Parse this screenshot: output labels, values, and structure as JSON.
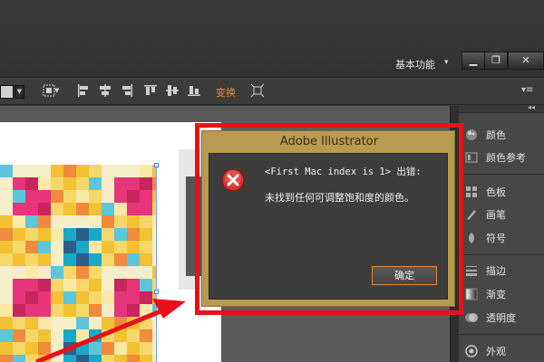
{
  "window": {
    "workspace_label": "基本功能",
    "workspace_caret": "▾",
    "minimize_glyph": "▁",
    "maximize_glyph": "❐",
    "close_glyph": "✕"
  },
  "control_bar": {
    "transform_link": "变换",
    "panel_menu_glyph": "▾≡"
  },
  "panels": [
    {
      "icon": "color-icon",
      "label": "颜色"
    },
    {
      "icon": "color-guide-icon",
      "label": "颜色参考"
    },
    {
      "icon": "swatches-icon",
      "label": "色板"
    },
    {
      "icon": "brushes-icon",
      "label": "画笔"
    },
    {
      "icon": "symbols-icon",
      "label": "符号"
    },
    {
      "icon": "stroke-icon",
      "label": "描边"
    },
    {
      "icon": "gradient-icon",
      "label": "渐变"
    },
    {
      "icon": "transparency-icon",
      "label": "透明度"
    },
    {
      "icon": "appearance-icon",
      "label": "外观"
    }
  ],
  "alert": {
    "title": "Adobe Illustrator",
    "line1": "<First Mac index is 1> 出错:",
    "line2": "未找到任何可调整饱和度的颜色。",
    "ok_label": "确定"
  },
  "colors": {
    "alert_frame": "#b89a52",
    "highlight_frame": "#e8101a",
    "accent_orange": "#e08a38",
    "error_red": "#d8322c"
  }
}
